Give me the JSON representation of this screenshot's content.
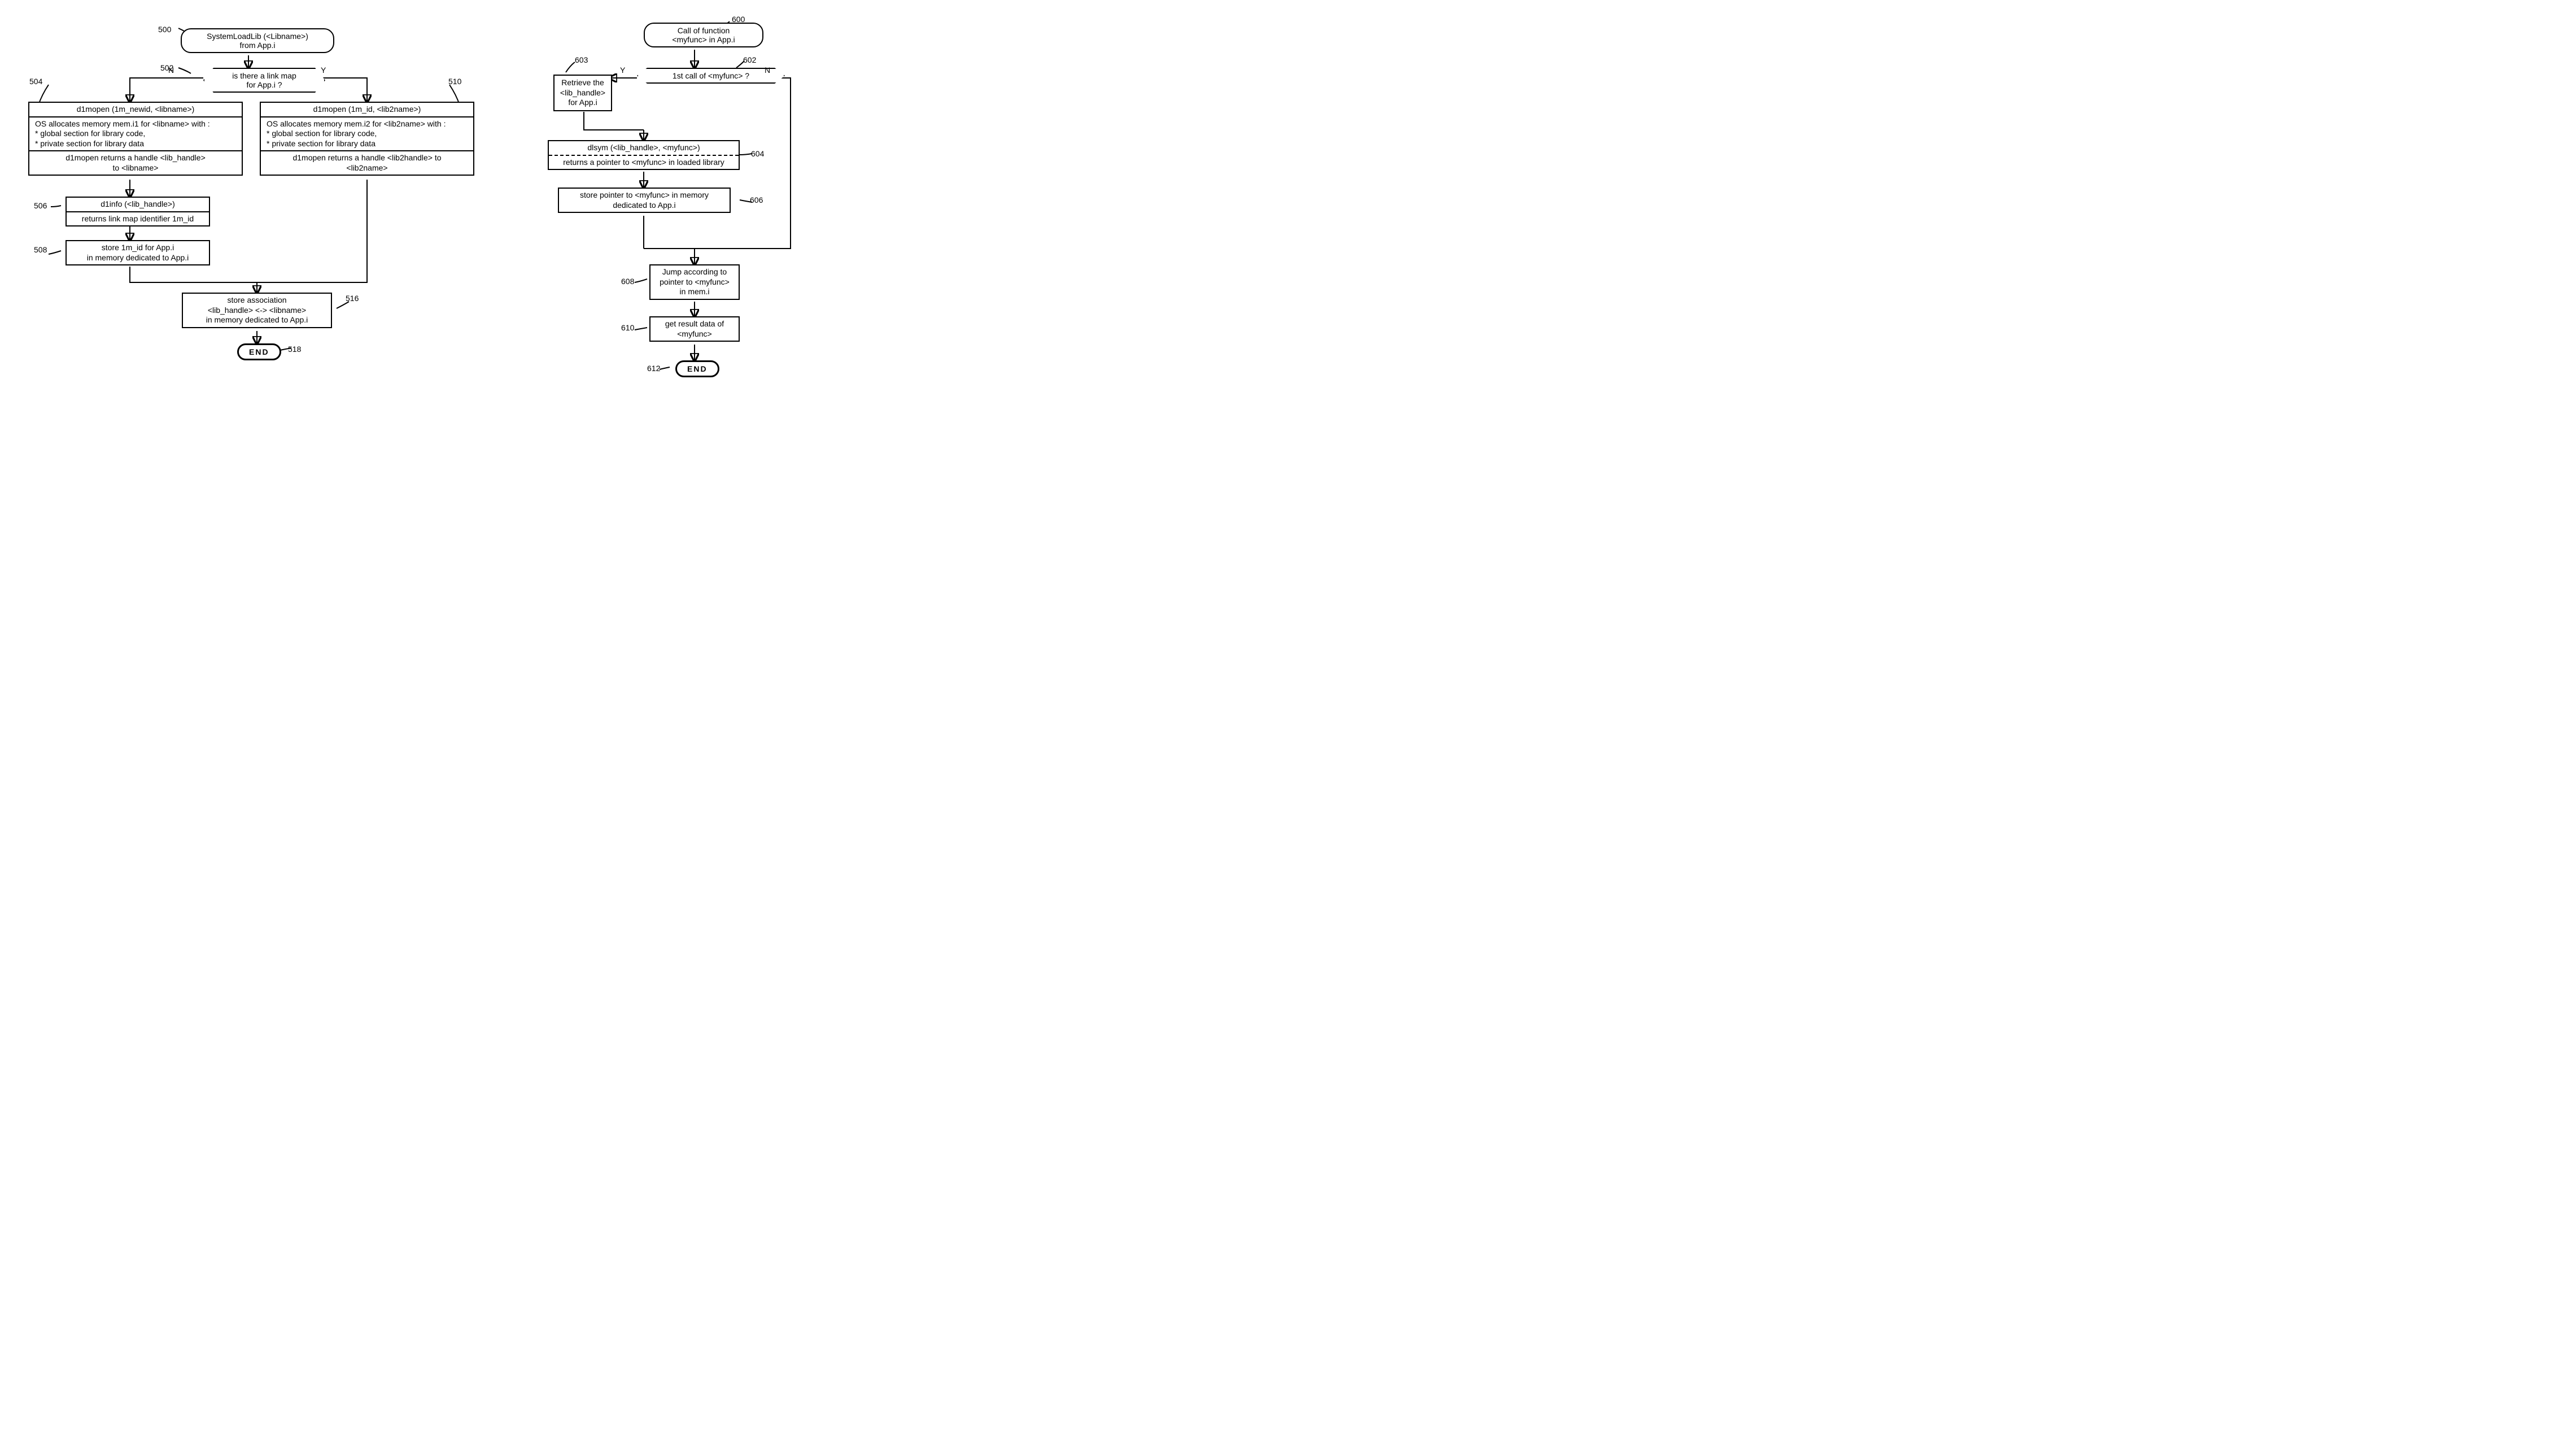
{
  "left": {
    "n500": {
      "l1": "SystemLoadLib (<Libname>)",
      "l2": "from App.i"
    },
    "n502": {
      "l1": "is there a link map",
      "l2": "for App.i ?"
    },
    "n504": {
      "h": "d1mopen (1m_newid, <libname>)",
      "b1": "OS allocates memory mem.i1 for <libname> with :",
      "b2": "* global section for library code,",
      "b3": "* private section for library data",
      "f1": "d1mopen returns a handle <lib_handle>",
      "f2": "to <libname>"
    },
    "n510": {
      "h": "d1mopen (1m_id, <lib2name>)",
      "b1": "OS allocates memory mem.i2 for <lib2name> with :",
      "b2": "* global section for library code,",
      "b3": "* private section for library data",
      "f1": "d1mopen returns a handle <lib2handle> to",
      "f2": "<lib2name>"
    },
    "n506": {
      "h": "d1info (<lib_handle>)",
      "b": "returns link map identifier 1m_id"
    },
    "n508": {
      "l1": "store 1m_id for App.i",
      "l2": "in memory dedicated to App.i"
    },
    "n516": {
      "l1": "store association",
      "l2": "<lib_handle> <-> <libname>",
      "l3": "in memory dedicated to App.i"
    },
    "n518": "END",
    "labels": {
      "l500": "500",
      "l502": "502",
      "l504": "504",
      "l506": "506",
      "l508": "508",
      "l510": "510",
      "l516": "516",
      "l518": "518",
      "N": "N",
      "Y": "Y"
    }
  },
  "right": {
    "n600": {
      "l1": "Call of function",
      "l2": "<myfunc> in App.i"
    },
    "n602": "1st call of <myfunc> ?",
    "n603": {
      "l1": "Retrieve the",
      "l2": "<lib_handle>",
      "l3": "for App.i"
    },
    "n604": {
      "h": "dlsym (<lib_handle>, <myfunc>)",
      "b": "returns a pointer to <myfunc> in loaded library"
    },
    "n606": {
      "l1": "store pointer to <myfunc> in memory",
      "l2": "dedicated to App.i"
    },
    "n608": {
      "l1": "Jump according to",
      "l2": "pointer to <myfunc>",
      "l3": "in mem.i"
    },
    "n610": {
      "l1": "get result data of",
      "l2": "<myfunc>"
    },
    "n612": "END",
    "labels": {
      "l600": "600",
      "l602": "602",
      "l603": "603",
      "l604": "604",
      "l606": "606",
      "l608": "608",
      "l610": "610",
      "l612": "612",
      "Y": "Y",
      "N": "N"
    }
  }
}
